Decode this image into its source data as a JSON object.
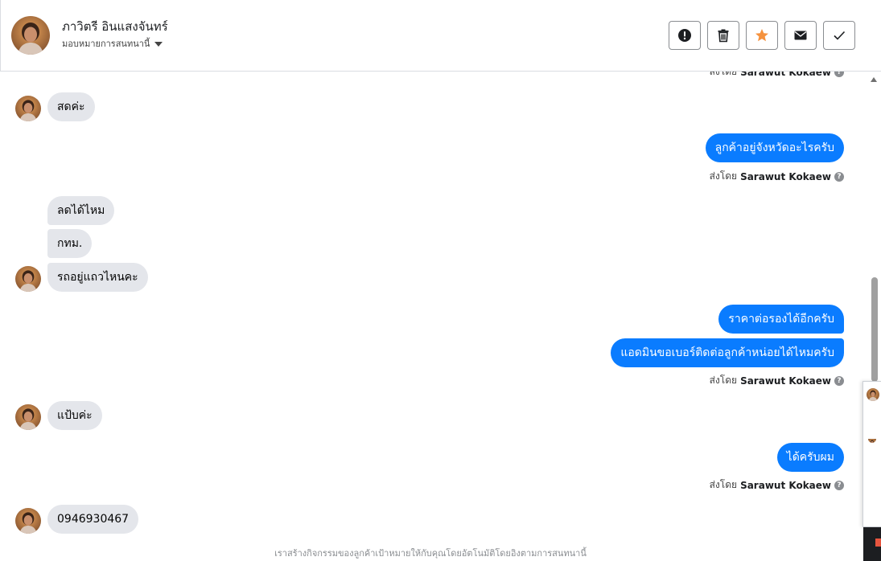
{
  "header": {
    "name": "ภาวิตรี อินแสงจันทร์",
    "subtitle": "มอบหมายการสนทนานี้",
    "actions": [
      {
        "icon": "alert-icon"
      },
      {
        "icon": "trash-icon"
      },
      {
        "icon": "star-icon",
        "color": "#f5923e"
      },
      {
        "icon": "envelope-icon"
      },
      {
        "icon": "checkmark-icon"
      }
    ]
  },
  "sender_prefix": "ส่งโดย",
  "sender_name": "Sarawut Kokaew",
  "messages": {
    "m1": "สดค่ะ",
    "m2": "ลูกค้าอยู่จังหวัดอะไรครับ",
    "m3": "ลดได้ไหม",
    "m4": "กทม.",
    "m5": "รถอยู่แถวไหนคะ",
    "m6": "ราคาต่อรองได้อีกครับ",
    "m7": "แอดมินขอเบอร์ติดต่อลูกค้าหน่อยได้ไหมครับ",
    "m8": "แป้บค่ะ",
    "m9": "ได้ครับผม",
    "m10": "0946930467"
  },
  "footer_note": "เราสร้างกิจกรรมของลูกค้าเป้าหมายให้กับคุณโดยอัตโนมัติโดยอิงตามการสนทนานี้",
  "colors": {
    "outgoing": "#0a7cff",
    "incoming": "#e4e6eb"
  }
}
